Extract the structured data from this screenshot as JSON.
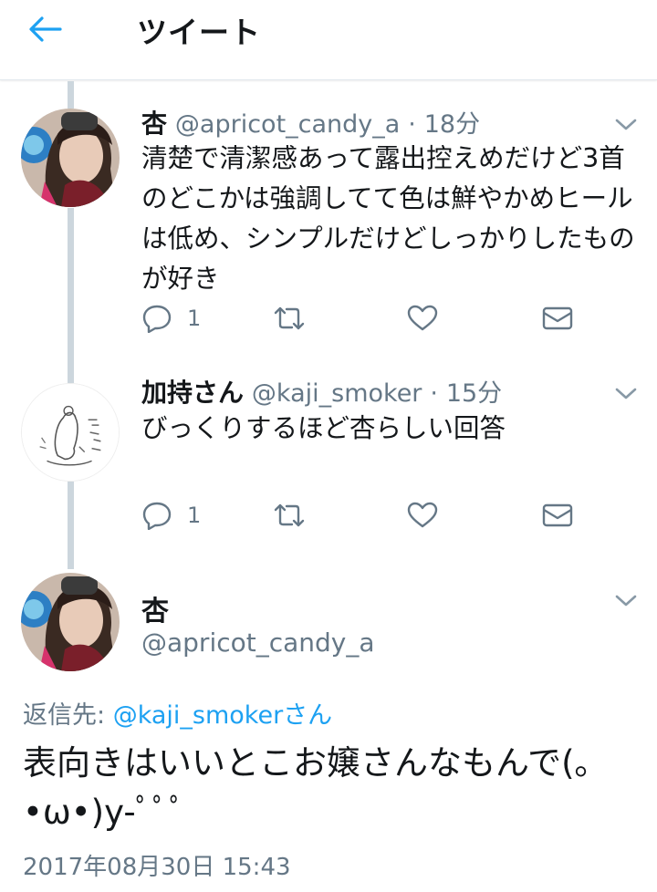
{
  "header": {
    "title": "ツイート",
    "back_icon": "arrow-left-icon"
  },
  "colors": {
    "accent": "#1da1f2",
    "muted": "#657786",
    "thread": "#ccd6dd"
  },
  "tweets": [
    {
      "name": "杏",
      "handle": "@apricot_candy_a",
      "separator": "·",
      "time": "18分",
      "text": "清楚で清潔感あって露出控えめだけど3首のどこかは強調してて色は鮮やかめヒールは低め、シンプルだけどしっかりしたものが好き",
      "reply_count": "1"
    },
    {
      "name": "加持さん",
      "handle": "@kaji_smoker",
      "separator": "·",
      "time": "15分",
      "text": "びっくりするほど杏らしい回答",
      "reply_count": "1"
    }
  ],
  "main_tweet": {
    "name": "杏",
    "handle": "@apricot_candy_a",
    "reply_prefix": "返信先: ",
    "reply_target": "@kaji_smokerさん",
    "text": "表向きはいいとこお嬢さんなもんで(｡•ω•)y-ﾟﾟﾟ",
    "date": "2017年08月30日 15:43"
  }
}
